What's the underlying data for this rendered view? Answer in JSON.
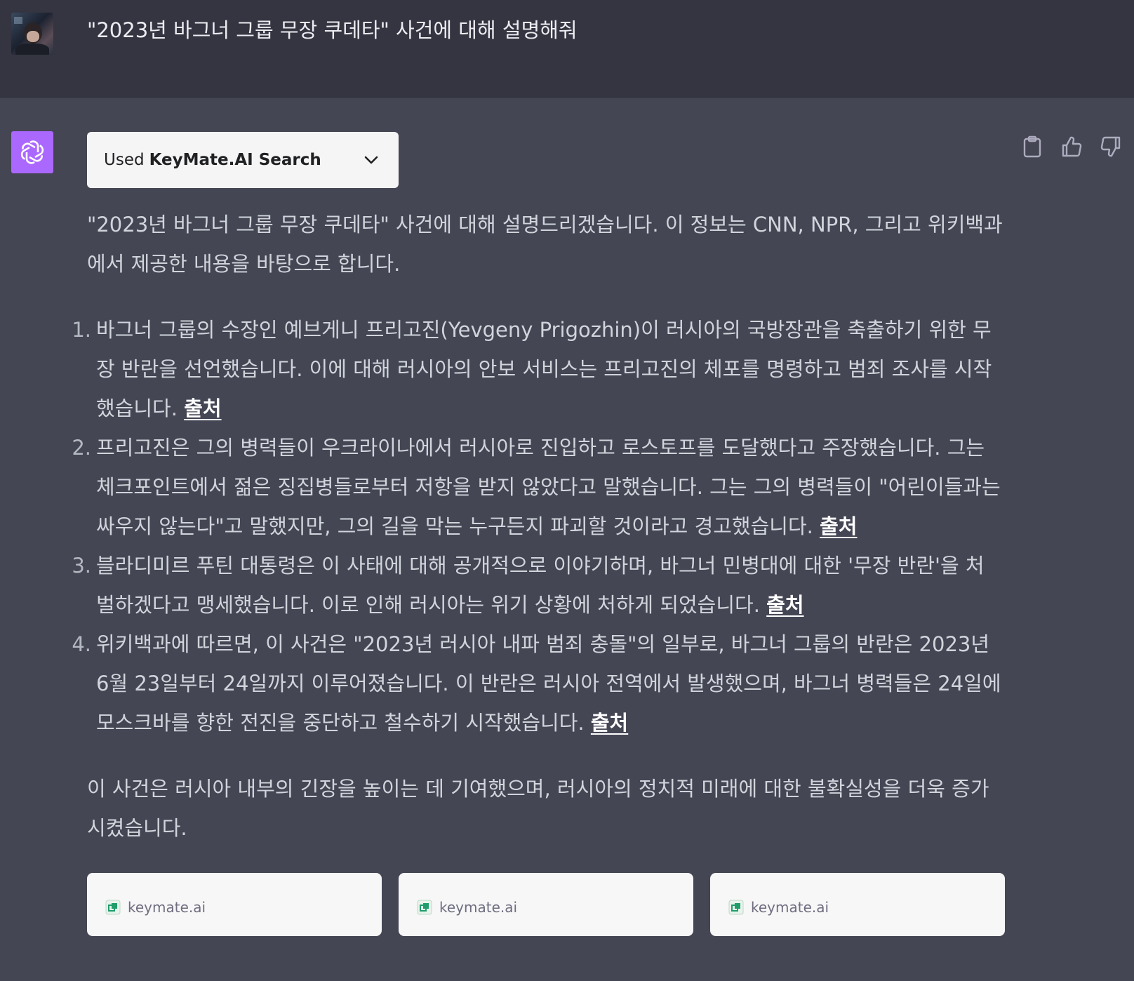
{
  "user_message": {
    "text": "\"2023년 바그너 그룹 무장 쿠데타\" 사건에 대해 설명해줘"
  },
  "assistant": {
    "plugin": {
      "used_label": "Used",
      "name": "KeyMate.AI Search"
    },
    "actions": {
      "copy": "copy-icon",
      "thumbs_up": "thumbs-up-icon",
      "thumbs_down": "thumbs-down-icon"
    },
    "intro": "\"2023년 바그너 그룹 무장 쿠데타\" 사건에 대해 설명드리겠습니다. 이 정보는 CNN, NPR, 그리고 위키백과에서 제공한 내용을 바탕으로 합니다.",
    "items": [
      {
        "num": "1.",
        "text": "바그너 그룹의 수장인 예브게니 프리고진(Yevgeny Prigozhin)이 러시아의 국방장관을 축출하기 위한 무장 반란을 선언했습니다. 이에 대해 러시아의 안보 서비스는 프리고진의 체포를 명령하고 범죄 조사를 시작했습니다.",
        "source": "출처"
      },
      {
        "num": "2.",
        "text": "프리고진은 그의 병력들이 우크라이나에서 러시아로 진입하고 로스토프를 도달했다고 주장했습니다. 그는 체크포인트에서 젊은 징집병들로부터 저항을 받지 않았다고 말했습니다. 그는 그의 병력들이 \"어린이들과는 싸우지 않는다\"고 말했지만, 그의 길을 막는 누구든지 파괴할 것이라고 경고했습니다.",
        "source": "출처"
      },
      {
        "num": "3.",
        "text": "블라디미르 푸틴 대통령은 이 사태에 대해 공개적으로 이야기하며, 바그너 민병대에 대한 '무장 반란'을 처벌하겠다고 맹세했습니다. 이로 인해 러시아는 위기 상황에 처하게 되었습니다.",
        "source": "출처"
      },
      {
        "num": "4.",
        "text": "위키백과에 따르면, 이 사건은 \"2023년 러시아 내파 범죄 충돌\"의 일부로, 바그너 그룹의 반란은 2023년 6월 23일부터 24일까지 이루어졌습니다. 이 반란은 러시아 전역에서 발생했으며, 바그너 병력들은 24일에 모스크바를 향한 전진을 중단하고 철수하기 시작했습니다.",
        "source": "출처"
      }
    ],
    "conclusion": "이 사건은 러시아 내부의 긴장을 높이는 데 기여했으며, 러시아의 정치적 미래에 대한 불확실성을 더욱 증가시켰습니다.",
    "sources": [
      {
        "domain": "keymate.ai"
      },
      {
        "domain": "keymate.ai"
      },
      {
        "domain": "keymate.ai"
      }
    ]
  }
}
